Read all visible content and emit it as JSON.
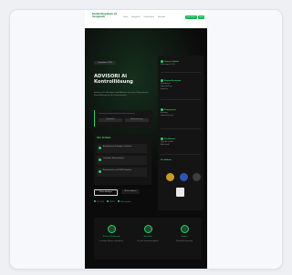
{
  "header": {
    "brand": "Kontrollsystem AI Vergleich",
    "nav": [
      "Start",
      "Vergleich",
      "Funktionen",
      "Kontakt"
    ],
    "cta_primary": "Jetzt testen",
    "cta_secondary": "Login"
  },
  "hero": {
    "pill": "Compliance 2025",
    "title": "ADVISORI AI Kontrolllösung",
    "lead": "Erhöhen Sie Sicherheit und Effizienz mit einer KI-gestützten Kontrolllösung für Ihr Unternehmen.",
    "quote_chips": [
      "Regulatorik",
      "Automatisierung"
    ],
    "benefits_title": "Ihre Vorteile",
    "benefits": [
      "Automatisierte Prüfungen in Echtzeit",
      "Lückenlose Dokumentation",
      "Revisionssicher und DSGVO-konform"
    ],
    "cta_start": "Demo anfragen",
    "cta_more": "Mehr erfahren",
    "tags": [
      "ISO 27001",
      "DSGVO",
      "BaFin-konform"
    ]
  },
  "sidebar": {
    "sections": [
      {
        "title": "Unsere Stärke",
        "lines": [
          "Erfahrung seit 2012"
        ]
      },
      {
        "title": "Kontrollsysteme",
        "lines": [
          "Risikoanalyse",
          "Prozessprüfung",
          "Reporting"
        ]
      },
      {
        "title": "Kompetenz",
        "lines": [
          "Beratung",
          "Implementierung"
        ]
      },
      {
        "title": "Zertifiziert",
        "lines": [
          "Geprüfte Qualität",
          "Audit-ready"
        ]
      }
    ],
    "badges_title": "Zertifikate"
  },
  "features": [
    {
      "title": "Schnelle Einführung",
      "desc": "In wenigen Wochen einsatzbereit"
    },
    {
      "title": "Skalierbar",
      "desc": "Für jede Unternehmensgröße"
    },
    {
      "title": "Support",
      "desc": "Persönliche Betreuung"
    }
  ],
  "colors": {
    "accent": "#2fd06a",
    "background": "#0b0b0b",
    "header": "#ffffff"
  }
}
